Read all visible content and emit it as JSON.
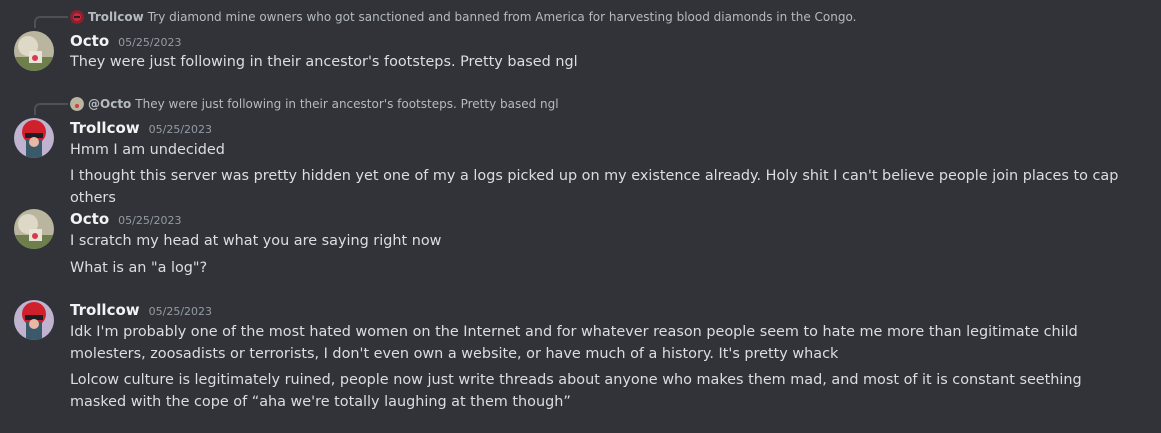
{
  "colors": {
    "background": "#313338",
    "text": "#dbdee1",
    "muted": "#949ba4"
  },
  "messages": [
    {
      "reply": {
        "author": "Trollcow",
        "text": "Try diamond mine owners who got sanctioned and banned from America for harvesting blood diamonds in the Congo."
      },
      "author": "Octo",
      "timestamp": "05/25/2023",
      "lines": [
        "They were just following in their ancestor's footsteps. Pretty based ngl"
      ]
    },
    {
      "reply": {
        "author": "@Octo",
        "text": "They were just following in their ancestor's footsteps. Pretty based ngl"
      },
      "author": "Trollcow",
      "timestamp": "05/25/2023",
      "lines": [
        "Hmm I am undecided",
        "I thought this server was pretty hidden yet one of my a logs picked up on my existence already. Holy shit I can't believe people join places to cap others"
      ]
    },
    {
      "author": "Octo",
      "timestamp": "05/25/2023",
      "lines": [
        "I scratch my head at what you are saying right now",
        "What is an \"a log\"?"
      ]
    },
    {
      "author": "Trollcow",
      "timestamp": "05/25/2023",
      "lines": [
        "Idk I'm probably one of the most hated women on the Internet and for whatever reason people seem to hate me more than legitimate child molesters, zoosadists or terrorists, I don't even own a website, or have much of a history. It's pretty whack",
        "Lolcow culture is legitimately ruined, people now just write threads about anyone who makes them mad, and most of it is constant seething masked with the cope of “aha we're totally laughing at them though”"
      ]
    }
  ]
}
